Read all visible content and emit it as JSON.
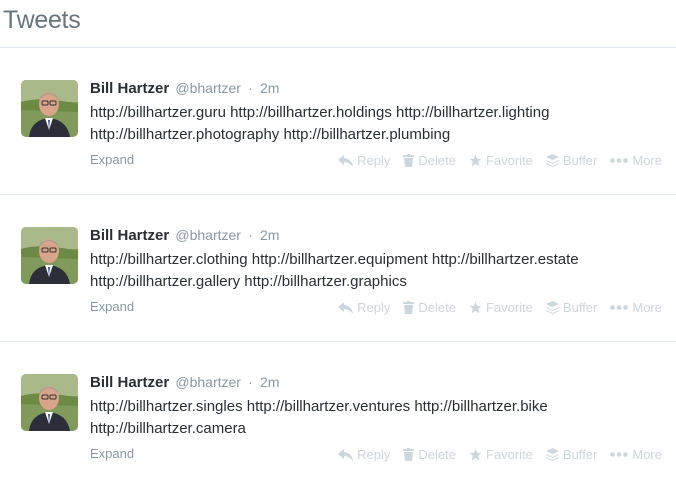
{
  "header": {
    "title": "Tweets"
  },
  "actions": {
    "reply": "Reply",
    "delete": "Delete",
    "favorite": "Favorite",
    "buffer": "Buffer",
    "more": "More"
  },
  "expand_label": "Expand",
  "tweets": [
    {
      "fullname": "Bill Hartzer",
      "username": "@bhartzer",
      "separator": "·",
      "time": "2m",
      "lines": [
        "http://billhartzer.guru http://billhartzer.holdings http://billhartzer.lighting",
        "http://billhartzer.photography http://billhartzer.plumbing"
      ]
    },
    {
      "fullname": "Bill Hartzer",
      "username": "@bhartzer",
      "separator": "·",
      "time": "2m",
      "lines": [
        "http://billhartzer.clothing http://billhartzer.equipment http://billhartzer.estate",
        "http://billhartzer.gallery http://billhartzer.graphics"
      ]
    },
    {
      "fullname": "Bill Hartzer",
      "username": "@bhartzer",
      "separator": "·",
      "time": "2m",
      "lines": [
        "http://billhartzer.singles http://billhartzer.ventures http://billhartzer.bike",
        "http://billhartzer.camera"
      ]
    }
  ]
}
